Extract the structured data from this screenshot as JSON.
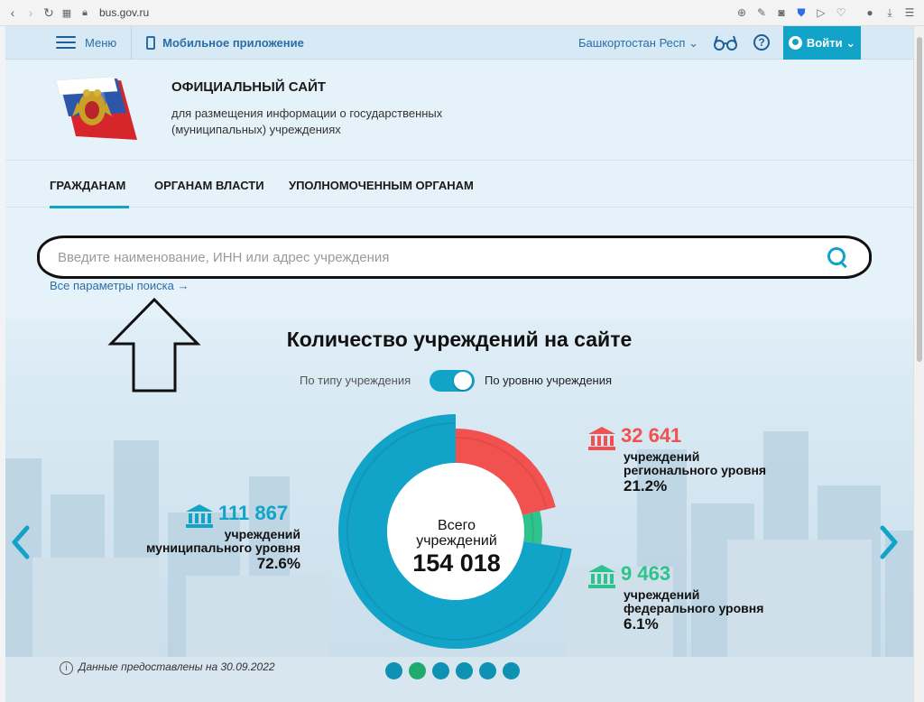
{
  "browser": {
    "url": "bus.gov.ru"
  },
  "topnav": {
    "menu_label": "Меню",
    "mobile_app_label": "Мобильное приложение",
    "region_label": "Башкортостан Респ",
    "login_label": "Войти",
    "help_symbol": "?"
  },
  "header": {
    "title": "ОФИЦИАЛЬНЫЙ САЙТ",
    "subtitle": "для размещения информации о государственных (муниципальных) учреждениях"
  },
  "section_nav": {
    "tabs": [
      {
        "label": "ГРАЖДАНАМ",
        "active": true
      },
      {
        "label": "ОРГАНАМ ВЛАСТИ",
        "active": false
      },
      {
        "label": "УПОЛНОМОЧЕННЫМ ОРГАНАМ",
        "active": false
      }
    ]
  },
  "search": {
    "placeholder": "Введите наименование, ИНН или адрес учреждения",
    "value": "",
    "all_params_link": "Все параметры поиска →"
  },
  "stats": {
    "title": "Количество учреждений на сайте",
    "toggle_left": "По типу учреждения",
    "toggle_right": "По уровню учреждения",
    "toggle_on": true,
    "total_label": "Всего учреждений",
    "total_value": "154 018",
    "municipal": {
      "value": "111 867",
      "label_line1": "учреждений",
      "label_line2": "муниципального уровня",
      "pct": "72.6%"
    },
    "regional": {
      "value": "32 641",
      "label_line1": "учреждений",
      "label_line2": "регионального уровня",
      "pct": "21.2%"
    },
    "federal": {
      "value": "9 463",
      "label_line1": "учреждений",
      "label_line2": "федерального уровня",
      "pct": "6.1%"
    },
    "footnote": "Данные предоставлены на 30.09.2022",
    "slides": 6,
    "active_slide": 2
  },
  "chart_data": {
    "type": "pie",
    "categories": [
      "муниципального уровня",
      "регионального уровня",
      "федерального уровня"
    ],
    "values": [
      111867,
      32641,
      9463
    ],
    "percents": [
      72.6,
      21.2,
      6.1
    ],
    "colors": [
      "#12a3c8",
      "#f2524f",
      "#2ec38c"
    ],
    "center_value": 154018
  },
  "colors": {
    "accent": "#12a3c8",
    "municipal": "#12a3c8",
    "regional": "#f2524f",
    "federal": "#2ec38c"
  }
}
